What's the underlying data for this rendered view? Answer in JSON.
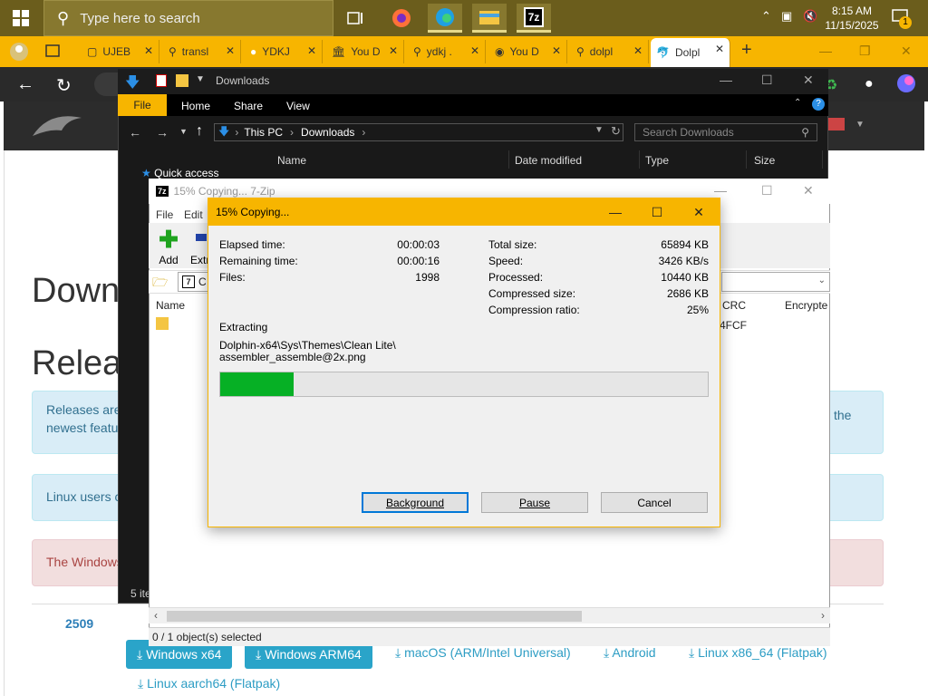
{
  "taskbar": {
    "search_placeholder": "Type here to search",
    "time": "8:15 AM",
    "date": "11/15/2025",
    "notification_count": "1",
    "app_7zip_label": "7z"
  },
  "browser": {
    "tabs": [
      {
        "label": "UJEB",
        "icon": "page-icon"
      },
      {
        "label": "transl",
        "icon": "search-icon"
      },
      {
        "label": "YDKJ",
        "icon": "game-icon"
      },
      {
        "label": "You D",
        "icon": "archive-icon"
      },
      {
        "label": "ydkj .",
        "icon": "search-icon"
      },
      {
        "label": "You D",
        "icon": "chat-icon"
      },
      {
        "label": "dolpl",
        "icon": "search-icon"
      },
      {
        "label": "Dolpl",
        "icon": "dolphin-icon"
      }
    ],
    "new_tab_label": "+"
  },
  "website": {
    "heading_download": "Downl",
    "heading_releases": "Relea",
    "alert1_left": "Releases are",
    "alert1_left2": "newest featu",
    "alert1_right": "the",
    "alert2_left": "Linux users c",
    "alert3_left": "The Windows",
    "version": "2509",
    "downloads": [
      "Windows x64",
      "Windows ARM64",
      "macOS (ARM/Intel Universal)",
      "Android",
      "Linux x86_64 (Flatpak)",
      "Linux aarch64 (Flatpak)"
    ]
  },
  "explorer": {
    "title": "Downloads",
    "ribbon": {
      "file": "File",
      "home": "Home",
      "share": "Share",
      "view": "View"
    },
    "path": [
      "This PC",
      "Downloads"
    ],
    "search_placeholder": "Search Downloads",
    "columns": [
      "Name",
      "Date modified",
      "Type",
      "Size"
    ],
    "quick_access": "Quick access",
    "status": "5 ite"
  },
  "zip_manager": {
    "title": "15% Copying... 7-Zip",
    "menu": [
      "File",
      "Edit"
    ],
    "toolbar": {
      "add": "Add",
      "extract": "Extr"
    },
    "columns": {
      "name": "Name",
      "crc": "CRC",
      "encrypted": "Encrypte"
    },
    "crc_value": "4FCF",
    "path_fragment": "C",
    "status": "0 / 1 object(s) selected"
  },
  "dialog": {
    "title": "15% Copying...",
    "left_stats": [
      {
        "label": "Elapsed time:",
        "value": "00:00:03"
      },
      {
        "label": "Remaining time:",
        "value": "00:00:16"
      },
      {
        "label": "Files:",
        "value": "1998"
      }
    ],
    "right_stats": [
      {
        "label": "Total size:",
        "value": "65894 KB"
      },
      {
        "label": "Speed:",
        "value": "3426 KB/s"
      },
      {
        "label": "Processed:",
        "value": "10440 KB"
      },
      {
        "label": "Compressed size:",
        "value": "2686 KB"
      },
      {
        "label": "Compression ratio:",
        "value": "25%"
      }
    ],
    "action": "Extracting",
    "file_line1": "Dolphin-x64\\Sys\\Themes\\Clean Lite\\",
    "file_line2": "assembler_assemble@2x.png",
    "progress": 0.15,
    "buttons": {
      "background": "Background",
      "pause": "Pause",
      "cancel": "Cancel"
    }
  },
  "colors": {
    "taskbar": "#6b5d1c",
    "accent": "#f7b500",
    "progress": "#06b025",
    "info": "#d9edf7",
    "danger": "#f2dede"
  }
}
